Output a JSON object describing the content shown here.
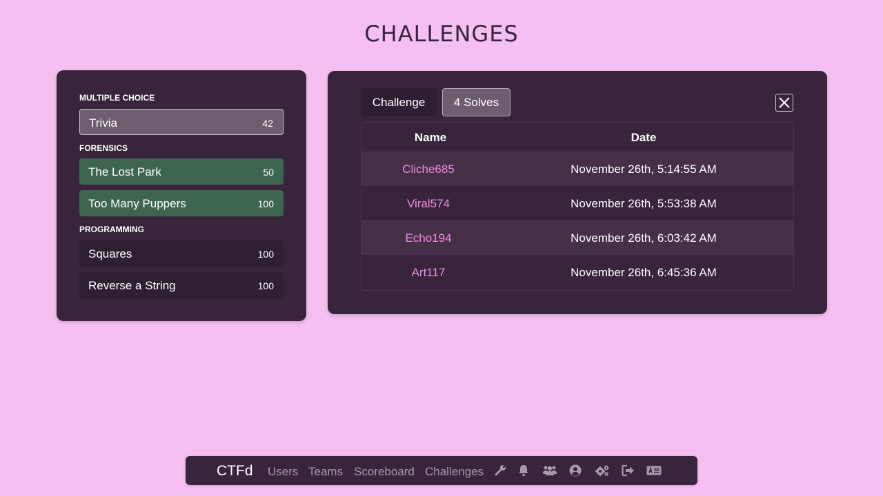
{
  "page": {
    "title": "CHALLENGES"
  },
  "categories": [
    {
      "name": "MULTIPLE CHOICE",
      "challenges": [
        {
          "name": "Trivia",
          "value": "42",
          "state": "active"
        }
      ]
    },
    {
      "name": "FORENSICS",
      "challenges": [
        {
          "name": "The Lost Park",
          "value": "50",
          "state": "solved"
        },
        {
          "name": "Too Many Puppers",
          "value": "100",
          "state": "solved"
        }
      ]
    },
    {
      "name": "PROGRAMMING",
      "challenges": [
        {
          "name": "Squares",
          "value": "100",
          "state": "unsolved"
        },
        {
          "name": "Reverse a String",
          "value": "100",
          "state": "unsolved"
        }
      ]
    }
  ],
  "modal": {
    "tabs": [
      {
        "label": "Challenge",
        "selected": false
      },
      {
        "label": "4 Solves",
        "selected": true
      }
    ],
    "close_icon": "close-icon",
    "table": {
      "headers": [
        "Name",
        "Date"
      ],
      "rows": [
        {
          "name": "Cliche685",
          "date": "November 26th, 5:14:55 AM"
        },
        {
          "name": "Viral574",
          "date": "November 26th, 5:53:38 AM"
        },
        {
          "name": "Echo194",
          "date": "November 26th, 6:03:42 AM"
        },
        {
          "name": "Art117",
          "date": "November 26th, 6:45:36 AM"
        }
      ]
    }
  },
  "navbar": {
    "brand": "CTFd",
    "links": [
      "Users",
      "Teams",
      "Scoreboard",
      "Challenges"
    ],
    "icons": [
      "wrench-icon",
      "bell-icon",
      "users-icon",
      "user-circle-icon",
      "cogs-icon",
      "sign-out-icon",
      "language-icon"
    ]
  },
  "colors": {
    "background": "#f5c0f1",
    "panel": "#38253c",
    "solved": "#3d6650",
    "accent_link": "#ee8be2"
  }
}
